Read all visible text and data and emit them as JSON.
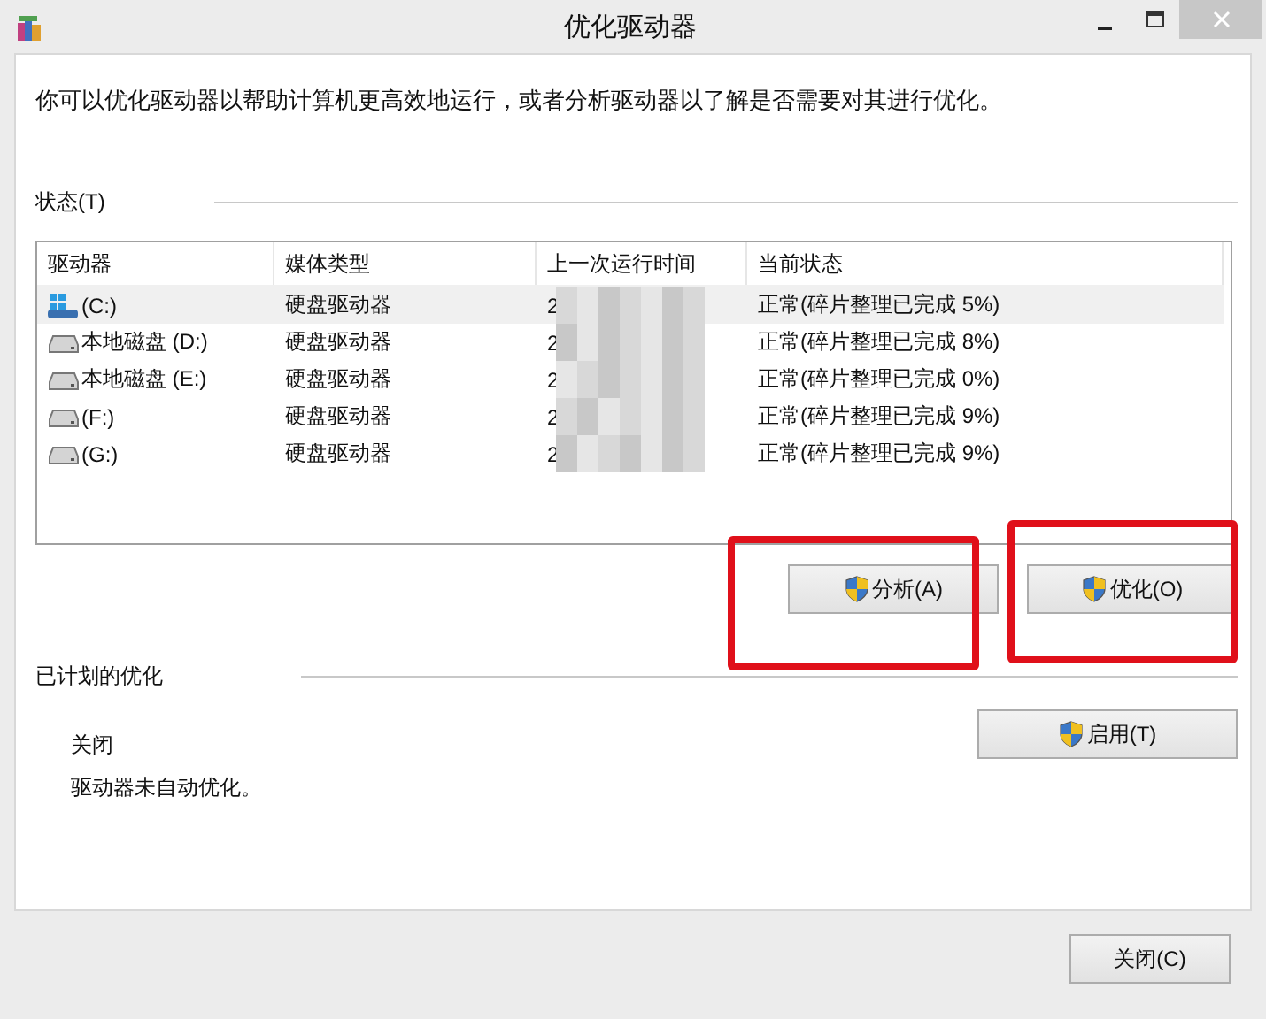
{
  "window": {
    "title": "优化驱动器"
  },
  "intro": "你可以优化驱动器以帮助计算机更高效地运行，或者分析驱动器以了解是否需要对其进行优化。",
  "status": {
    "heading": "状态(T)",
    "columns": [
      "驱动器",
      "媒体类型",
      "上一次运行时间",
      "当前状态"
    ],
    "rows": [
      {
        "kind": "system",
        "drive": "(C:)",
        "media": "硬盘驱动器",
        "last_run": "2",
        "state": "正常(碎片整理已完成 5%)",
        "selected": true
      },
      {
        "kind": "disk",
        "drive": "本地磁盘 (D:)",
        "media": "硬盘驱动器",
        "last_run": "2",
        "state": "正常(碎片整理已完成 8%)",
        "selected": false
      },
      {
        "kind": "disk",
        "drive": "本地磁盘 (E:)",
        "media": "硬盘驱动器",
        "last_run": "2",
        "state": "正常(碎片整理已完成 0%)",
        "selected": false
      },
      {
        "kind": "disk",
        "drive": "(F:)",
        "media": "硬盘驱动器",
        "last_run": "2",
        "state": "正常(碎片整理已完成 9%)",
        "selected": false
      },
      {
        "kind": "disk",
        "drive": "(G:)",
        "media": "硬盘驱动器",
        "last_run": "2",
        "state": "正常(碎片整理已完成 9%)",
        "selected": false
      }
    ],
    "buttons": [
      "分析(A)",
      "优化(O)"
    ]
  },
  "scheduled": {
    "heading": "已计划的优化",
    "state": "关闭",
    "description": "驱动器未自动优化。",
    "button": "启用(T)"
  },
  "footer": {
    "button": "关闭(C)"
  }
}
